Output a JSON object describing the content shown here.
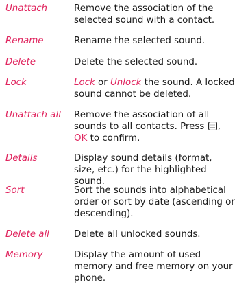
{
  "entries": [
    {
      "term": "Unattach",
      "description": "Remove the association of the selected sound with a contact."
    },
    {
      "term": "Rename",
      "description": "Rename the selected sound."
    },
    {
      "term": "Delete",
      "description": "Delete the selected sound."
    },
    {
      "term": "Lock",
      "description_lock": "Lock",
      "description_or": " or ",
      "description_unlock": "Unlock",
      "description_rest": " the sound. A locked sound cannot be deleted."
    },
    {
      "term": "Unattach all",
      "description_pre": "Remove the association of all sounds to all contacts. Press ",
      "description_comma": ",",
      "description_ok": "OK",
      "description_post": " to confirm."
    },
    {
      "term": "Details",
      "description": "Display sound details (format, size, etc.) for the highlighted sound."
    },
    {
      "term": "Sort",
      "description": "Sort the sounds into alphabetical order or sort by date (ascending or descending)."
    },
    {
      "term": "Delete all",
      "description": "Delete all unlocked sounds."
    },
    {
      "term": "Memory",
      "description": "Display the amount of used memory and free memory on your phone."
    }
  ],
  "colors": {
    "accent": "#e0245e",
    "text": "#1a1a1a"
  },
  "icons": {
    "menu_key": "menu-key-icon"
  }
}
